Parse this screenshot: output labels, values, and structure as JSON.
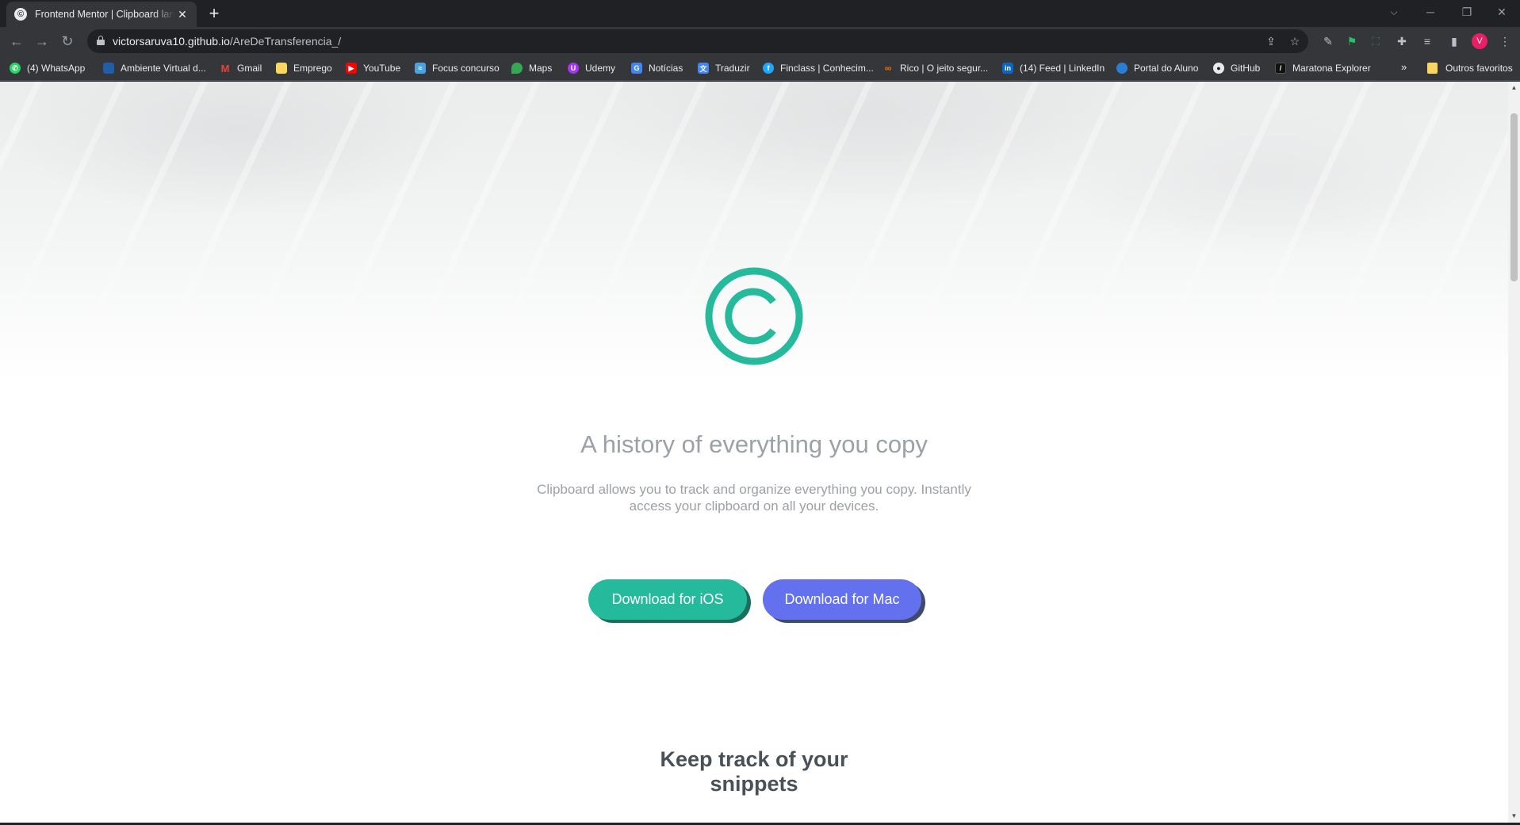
{
  "browser": {
    "tab_title": "Frontend Mentor | Clipboard landing page",
    "tab_close": "✕",
    "new_tab": "+",
    "url_host": "victorsaruva10.github.io",
    "url_path": "/AreDeTransferencia_/",
    "profile_initial": "V"
  },
  "bookmarks": [
    {
      "label": "(4) WhatsApp",
      "icon": "whatsapp-icon",
      "color": "#25d366"
    },
    {
      "label": "Ambiente Virtual d...",
      "icon": "school-icon",
      "color": "#1e5fa8"
    },
    {
      "label": "Gmail",
      "icon": "gmail-icon",
      "color": "#ea4335"
    },
    {
      "label": "Emprego",
      "icon": "folder-icon",
      "color": "#f9d75e"
    },
    {
      "label": "YouTube",
      "icon": "youtube-icon",
      "color": "#ff0000"
    },
    {
      "label": "Focus concurso",
      "icon": "focus-icon",
      "color": "#4aa3df"
    },
    {
      "label": "Maps",
      "icon": "maps-icon",
      "color": "#34a853"
    },
    {
      "label": "Udemy",
      "icon": "udemy-icon",
      "color": "#a435f0"
    },
    {
      "label": "Notícias",
      "icon": "news-icon",
      "color": "#4285f4"
    },
    {
      "label": "Traduzir",
      "icon": "translate-icon",
      "color": "#4285f4"
    },
    {
      "label": "Finclass | Conhecim...",
      "icon": "finclass-icon",
      "color": "#1ea7fd"
    },
    {
      "label": "Rico | O jeito segur...",
      "icon": "rico-icon",
      "color": "#ff6a00"
    },
    {
      "label": "(14) Feed | LinkedIn",
      "icon": "linkedin-icon",
      "color": "#0a66c2"
    },
    {
      "label": "Portal do Aluno",
      "icon": "portal-icon",
      "color": "#2a7fd4"
    },
    {
      "label": "GitHub",
      "icon": "github-icon",
      "color": "#e8eaed"
    },
    {
      "label": "Maratona Explorer",
      "icon": "explorer-icon",
      "color": "#111111"
    }
  ],
  "bookmarks_more": "»",
  "bookmarks_other": "Outros favoritos",
  "page": {
    "hero_title": "A history of everything you copy",
    "hero_text": "Clipboard allows you to track and organize everything you copy. Instantly access your clipboard on all your devices.",
    "btn_ios": "Download for iOS",
    "btn_mac": "Download for Mac",
    "section_title_line1": "Keep track of your",
    "section_title_line2": "snippets"
  },
  "colors": {
    "accent_green": "#26ba9d",
    "accent_blue": "#6371ef",
    "text_gray": "#9ba1a7",
    "heading_dark": "#4a5058"
  }
}
